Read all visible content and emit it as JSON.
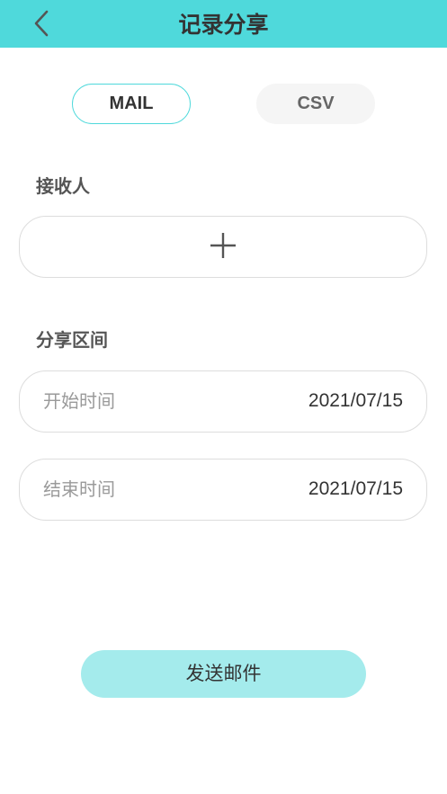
{
  "header": {
    "title": "记录分享",
    "back_icon": "chevron-left-icon",
    "background_color": "#4fd9db"
  },
  "tabs": [
    {
      "label": "MAIL",
      "selected": true
    },
    {
      "label": "CSV",
      "selected": false
    }
  ],
  "recipients": {
    "label": "接收人",
    "add_icon": "plus-icon"
  },
  "range": {
    "label": "分享区间",
    "start": {
      "label": "开始时间",
      "value": "2021/07/15"
    },
    "end": {
      "label": "结束时间",
      "value": "2021/07/15"
    }
  },
  "send_button": {
    "label": "发送邮件",
    "color": "#a4ebec"
  }
}
